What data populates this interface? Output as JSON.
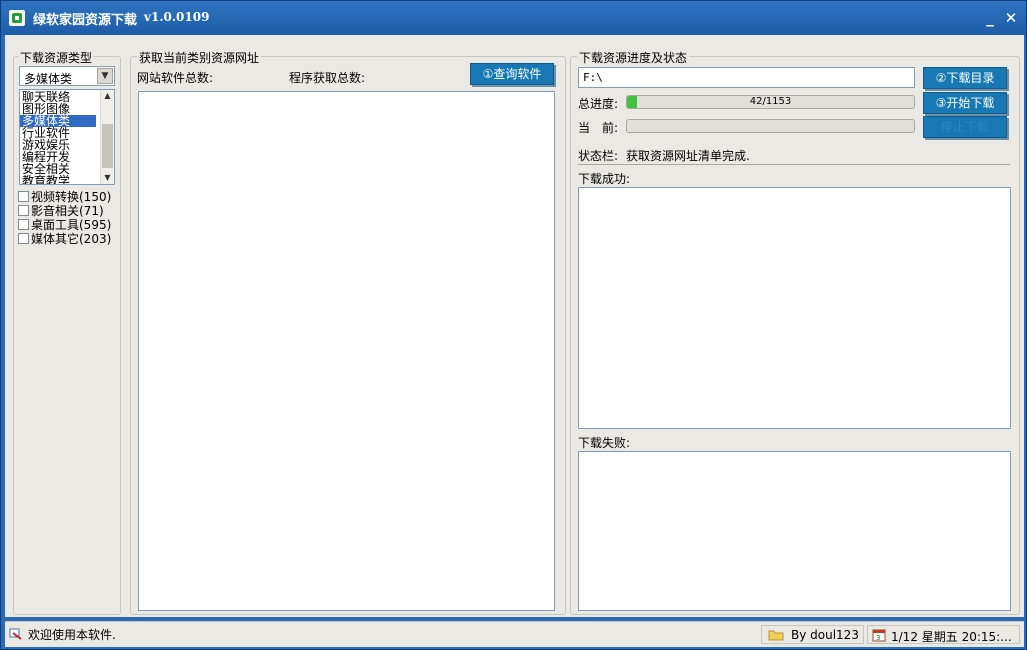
{
  "window": {
    "title": "绿软家园资源下载",
    "version": "v1.0.0109"
  },
  "left_panel": {
    "group_label": "下载资源类型",
    "combo_value": "多媒体类",
    "categories": [
      "聊天联络",
      "图形图像",
      "多媒体类",
      "行业软件",
      "游戏娱乐",
      "编程开发",
      "安全相关",
      "教育教学"
    ],
    "selected_index": 2,
    "subcategories": [
      {
        "label": "视频转换(150)",
        "checked": false
      },
      {
        "label": "影音相关(71)",
        "checked": false
      },
      {
        "label": "桌面工具(595)",
        "checked": false
      },
      {
        "label": "媒体其它(203)",
        "checked": false
      }
    ]
  },
  "middle_panel": {
    "group_label": "获取当前类别资源网址",
    "site_total_label": "网站软件总数:",
    "program_total_label": "程序获取总数:",
    "query_button": "①查询软件"
  },
  "right_panel": {
    "group_label": "下载资源进度及状态",
    "path_value": "F:\\",
    "dir_button": "②下载目录",
    "start_button": "③开始下载",
    "stop_button": "停止下载",
    "total_label": "总进度:",
    "total_progress_text": "42/1153",
    "total_progress_fraction": 0.036,
    "current_label": "当　前:",
    "current_progress_fraction": 0,
    "status_label": "状态栏:",
    "status_text": "获取资源网址清单完成.",
    "success_label": "下载成功:",
    "fail_label": "下载失败:"
  },
  "statusbar": {
    "welcome": "欢迎使用本软件.",
    "author": "By doul123",
    "datetime": "1/12 星期五 20:15:..."
  },
  "colors": {
    "title_bar": "#1d5ca6",
    "button_blue": "#1778b3",
    "progress_green": "#3fc23f",
    "selection": "#316ac5"
  }
}
